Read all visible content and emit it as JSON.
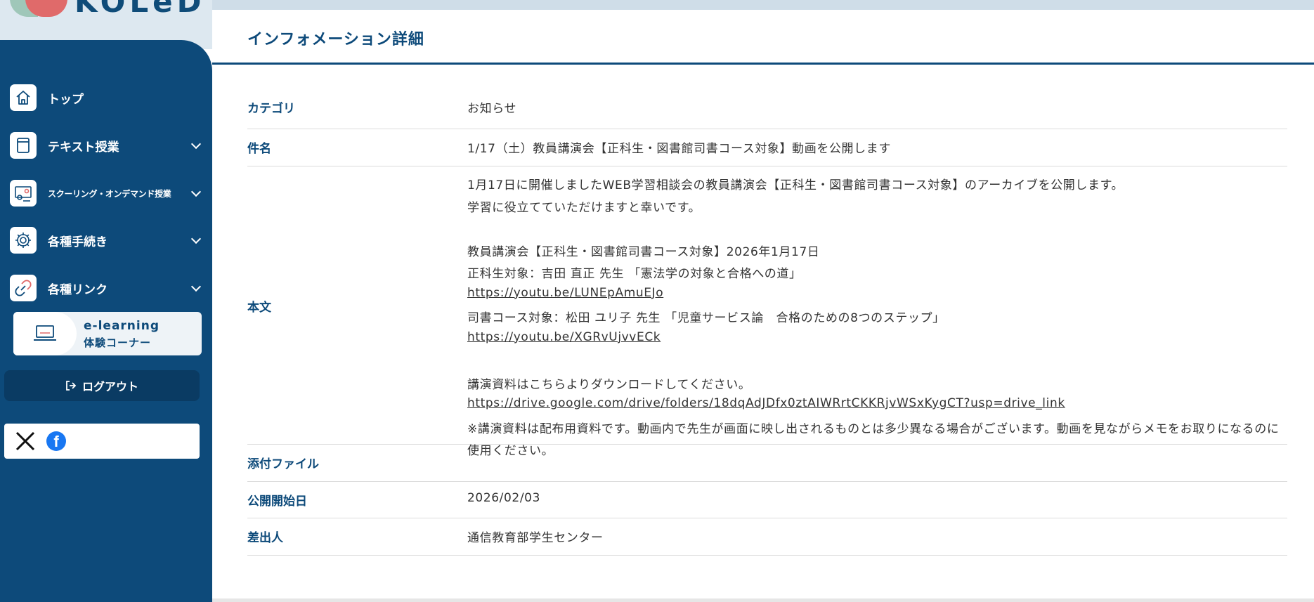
{
  "app": {
    "logo_text": "KOLeD",
    "accent": "#0d4a7a"
  },
  "sidebar": {
    "items": [
      {
        "label": "トップ",
        "icon": "home-icon",
        "has_submenu": false
      },
      {
        "label": "テキスト授業",
        "icon": "book-icon",
        "has_submenu": true
      },
      {
        "label": "スクーリング・オンデマンド授業",
        "icon": "video-class-icon",
        "has_submenu": true
      },
      {
        "label": "各種手続き",
        "icon": "gear-icon",
        "has_submenu": true
      },
      {
        "label": "各種リンク",
        "icon": "link-icon",
        "has_submenu": true
      }
    ],
    "elearning": {
      "line1": "e-learning",
      "line2": "体験コーナー"
    },
    "logout_label": "ログアウト",
    "social": [
      "x-icon",
      "facebook-icon"
    ]
  },
  "page": {
    "title": "インフォメーション詳細"
  },
  "detail": {
    "category_label": "カテゴリ",
    "category_value": "お知らせ",
    "subject_label": "件名",
    "subject_value": "1/17（土）教員講演会【正科生・図書館司書コース対象】動画を公開します",
    "body_label": "本文",
    "body_lines": [
      "1月17日に開催しましたWEB学習相談会の教員講演会【正科生・図書館司書コース対象】のアーカイブを公開します。",
      "学習に役立てていただけますと幸いです。",
      "",
      "教員講演会【正科生・図書館司書コース対象】2026年1月17日",
      "正科生対象：吉田 直正 先生 「憲法学の対象と合格への道」",
      "https://youtu.be/LUNEpAmuEJo",
      "司書コース対象：松田 ユリ子 先生 「児童サービス論　合格のための8つのステップ」",
      "https://youtu.be/XGRvUjvvECk",
      "",
      "講演資料はこちらよりダウンロードしてください。",
      "https://drive.google.com/drive/folders/18dqAdJDfx0ztAIWRrtCKKRjvWSxKygCT?usp=drive_link",
      "※講演資料は配布用資料です。動画内で先生が画面に映し出されるものとは多少異なる場合がございます。動画を見ながらメモをお取りになるのに使用ください。"
    ],
    "attachment_label": "添付ファイル",
    "attachment_value": "",
    "publish_label": "公開開始日",
    "publish_value": "2026/02/03",
    "sender_label": "差出人",
    "sender_value": "通信教育部学生センター"
  }
}
